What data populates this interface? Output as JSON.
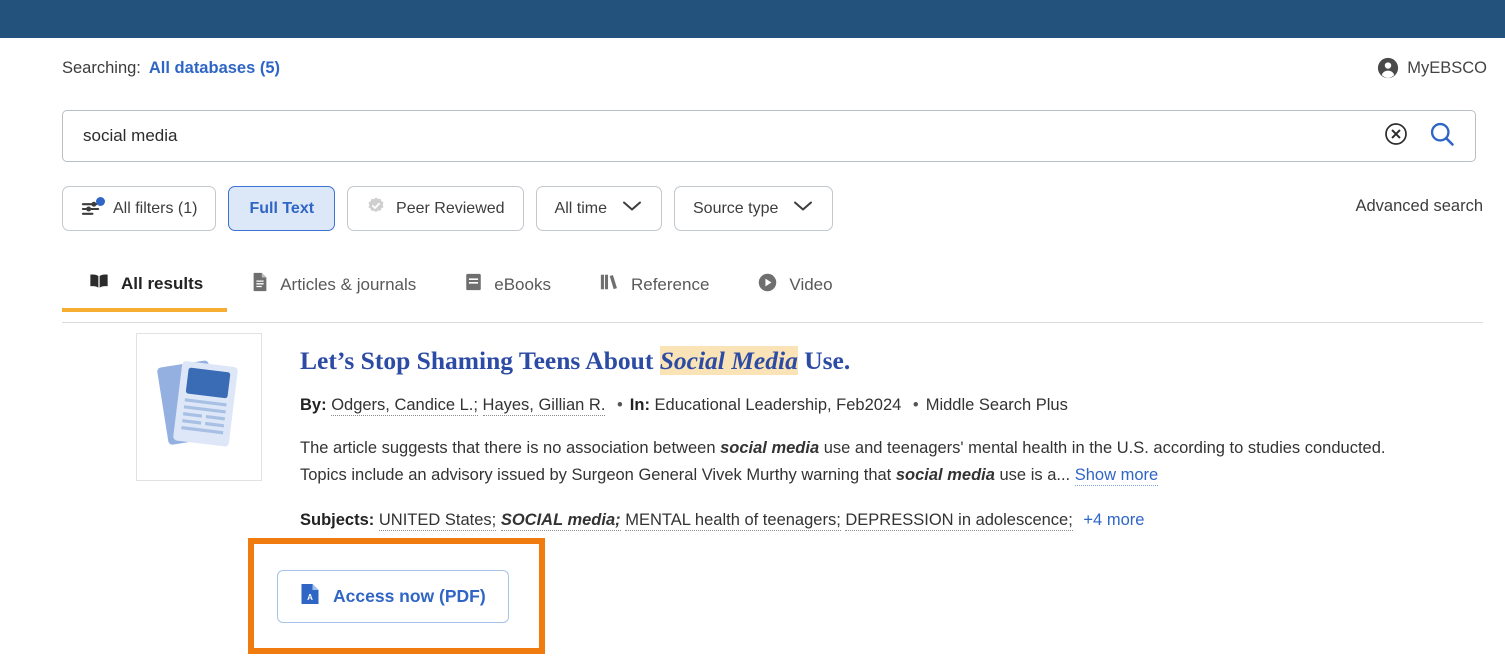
{
  "header": {
    "searching_label": "Searching:",
    "database_link": "All databases (5)",
    "account_label": "MyEBSCO",
    "account_icon": "person-circle-icon"
  },
  "search": {
    "value": "social media",
    "placeholder": "Search",
    "clear_icon": "circle-x-icon",
    "search_icon": "magnifier-icon"
  },
  "filters": {
    "all_filters": {
      "label": "All filters (1)",
      "icon": "filter-sliders-icon",
      "badge": true
    },
    "full_text": {
      "label": "Full Text",
      "active": true
    },
    "peer_reviewed": {
      "label": "Peer Reviewed",
      "icon": "verified-badge-icon"
    },
    "all_time": {
      "label": "All time",
      "icon": "chevron-down-icon"
    },
    "source_type": {
      "label": "Source type",
      "icon": "chevron-down-icon"
    },
    "advanced_search": "Advanced search"
  },
  "tabs": [
    {
      "label": "All results",
      "icon": "open-book-icon",
      "active": true
    },
    {
      "label": "Articles & journals",
      "icon": "document-icon",
      "active": false
    },
    {
      "label": "eBooks",
      "icon": "closed-book-icon",
      "active": false
    },
    {
      "label": "Reference",
      "icon": "bookshelf-icon",
      "active": false
    },
    {
      "label": "Video",
      "icon": "play-circle-icon",
      "active": false
    }
  ],
  "result": {
    "thumbnail_icon": "newspaper-thumbnail",
    "title_before": "Let’s Stop Shaming Teens About ",
    "title_highlight": "Social Media",
    "title_after": " Use.",
    "by_label": "By:",
    "authors": [
      "Odgers, Candice L.;",
      "Hayes, Gillian R."
    ],
    "in_label": "In:",
    "source": "Educational Leadership, Feb2024",
    "database": "Middle Search Plus",
    "abstract_part1": "The article suggests that there is no association between ",
    "abstract_bold1": "social media",
    "abstract_part2": " use and teenagers' mental health in the U.S. according to studies conducted. Topics include an advisory issued by Surgeon General Vivek Murthy warning that ",
    "abstract_bold2": "social media",
    "abstract_part3": " use is a...",
    "show_more": "Show more",
    "subjects_label": "Subjects:",
    "subjects": [
      {
        "text": "UNITED States;",
        "bold_italic": false
      },
      {
        "text": "SOCIAL media;",
        "bold_italic": true
      },
      {
        "text": "MENTAL health of teenagers;",
        "bold_italic": false
      },
      {
        "text": "DEPRESSION in adolescence;",
        "bold_italic": false
      }
    ],
    "subjects_more": "+4 more",
    "access_button": {
      "label": "Access now (PDF)",
      "icon": "pdf-file-icon"
    }
  },
  "colors": {
    "banner": "#23527c",
    "link_blue": "#2f66c5",
    "title_blue": "#2c4ba4",
    "highlight": "#fbe3b8",
    "tab_underline": "#f6ad32",
    "annotation": "#f07c10",
    "active_pill_bg": "#dce7f8"
  }
}
